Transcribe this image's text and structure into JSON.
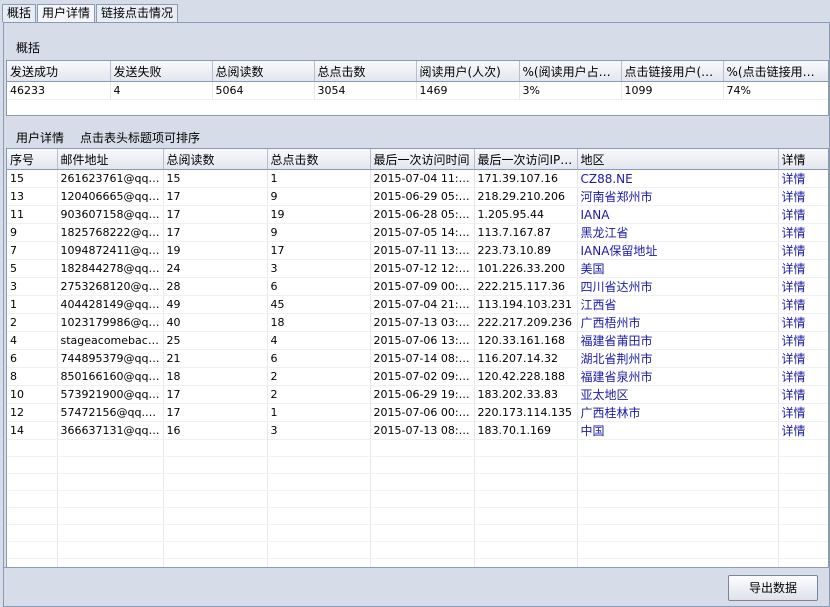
{
  "tabs": [
    {
      "label": "概括",
      "active": false
    },
    {
      "label": "用户详情",
      "active": true
    },
    {
      "label": "链接点击情况",
      "active": false
    }
  ],
  "summary": {
    "title": "概括",
    "headers": [
      "发送成功",
      "发送失败",
      "总阅读数",
      "总点击数",
      "阅读用户(人次)",
      "%(阅读用户占发…",
      "点击链接用户(…",
      "%(点击链接用户…"
    ],
    "values": [
      "46233",
      "4",
      "5064",
      "3054",
      "1469",
      "3%",
      "1099",
      "74%"
    ]
  },
  "details": {
    "title": "用户详情",
    "hint": "点击表头标题项可排序",
    "headers": [
      "序号",
      "邮件地址",
      "总阅读数",
      "总点击数",
      "最后一次访问时间",
      "最后一次访问IP…",
      "地区",
      "详情"
    ],
    "rows": [
      {
        "id": "15",
        "email": "261623761@qq.…",
        "reads": "15",
        "clicks": "1",
        "time": "2015-07-04 11:…",
        "ip": "171.39.107.16",
        "region": "CZ88.NE",
        "detail": "详情"
      },
      {
        "id": "13",
        "email": "120406665@qq.…",
        "reads": "17",
        "clicks": "9",
        "time": "2015-06-29 05:…",
        "ip": "218.29.210.206",
        "region": "河南省郑州市",
        "detail": "详情"
      },
      {
        "id": "11",
        "email": "903607158@qq.…",
        "reads": "17",
        "clicks": "19",
        "time": "2015-06-28 05:…",
        "ip": "1.205.95.44",
        "region": "IANA",
        "detail": "详情"
      },
      {
        "id": "9",
        "email": "1825768222@q…",
        "reads": "17",
        "clicks": "9",
        "time": "2015-07-05 14:…",
        "ip": "113.7.167.87",
        "region": "黑龙江省",
        "detail": "详情"
      },
      {
        "id": "7",
        "email": "1094872411@q…",
        "reads": "19",
        "clicks": "17",
        "time": "2015-07-11 13:…",
        "ip": "223.73.10.89",
        "region": "IANA保留地址",
        "detail": "详情"
      },
      {
        "id": "5",
        "email": "182844278@qq.…",
        "reads": "24",
        "clicks": "3",
        "time": "2015-07-12 12:…",
        "ip": "101.226.33.200",
        "region": "美国",
        "detail": "详情"
      },
      {
        "id": "3",
        "email": "2753268120@q…",
        "reads": "28",
        "clicks": "6",
        "time": "2015-07-09 00:…",
        "ip": "222.215.117.36",
        "region": "四川省达州市",
        "detail": "详情"
      },
      {
        "id": "1",
        "email": "404428149@qq.…",
        "reads": "49",
        "clicks": "45",
        "time": "2015-07-04 21:…",
        "ip": "113.194.103.231",
        "region": "江西省",
        "detail": "详情"
      },
      {
        "id": "2",
        "email": "1023179986@q…",
        "reads": "40",
        "clicks": "18",
        "time": "2015-07-13 03:…",
        "ip": "222.217.209.236",
        "region": "广西梧州市",
        "detail": "详情"
      },
      {
        "id": "4",
        "email": "stageacomeback…",
        "reads": "25",
        "clicks": "4",
        "time": "2015-07-06 13:…",
        "ip": "120.33.161.168",
        "region": "福建省莆田市",
        "detail": "详情"
      },
      {
        "id": "6",
        "email": "744895379@qq.…",
        "reads": "21",
        "clicks": "6",
        "time": "2015-07-14 08:…",
        "ip": "116.207.14.32",
        "region": "湖北省荆州市",
        "detail": "详情"
      },
      {
        "id": "8",
        "email": "850166160@qq.…",
        "reads": "18",
        "clicks": "2",
        "time": "2015-07-02 09:…",
        "ip": "120.42.228.188",
        "region": "福建省泉州市",
        "detail": "详情"
      },
      {
        "id": "10",
        "email": "573921900@qq.…",
        "reads": "17",
        "clicks": "2",
        "time": "2015-06-29 19:…",
        "ip": "183.202.33.83",
        "region": "亚太地区",
        "detail": "详情"
      },
      {
        "id": "12",
        "email": "57472156@qq.com",
        "reads": "17",
        "clicks": "1",
        "time": "2015-07-06 00:…",
        "ip": "220.173.114.135",
        "region": "广西桂林市",
        "detail": "详情"
      },
      {
        "id": "14",
        "email": "366637131@qq.…",
        "reads": "16",
        "clicks": "3",
        "time": "2015-07-13 08:…",
        "ip": "183.70.1.169",
        "region": "中国",
        "detail": "详情"
      }
    ]
  },
  "export_button": "导出数据"
}
